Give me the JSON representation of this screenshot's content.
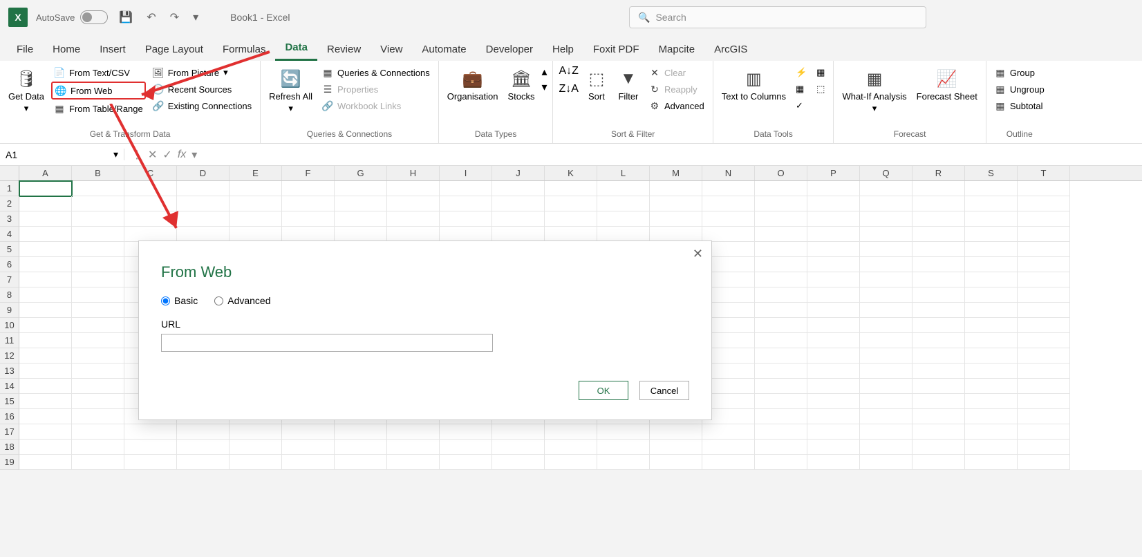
{
  "titlebar": {
    "autosave": "AutoSave",
    "doc_title": "Book1  - Excel",
    "search_placeholder": "Search"
  },
  "tabs": [
    "File",
    "Home",
    "Insert",
    "Page Layout",
    "Formulas",
    "Data",
    "Review",
    "View",
    "Automate",
    "Developer",
    "Help",
    "Foxit PDF",
    "Mapcite",
    "ArcGIS"
  ],
  "active_tab": "Data",
  "ribbon": {
    "get_transform": {
      "get_data": "Get Data",
      "from_text_csv": "From Text/CSV",
      "from_web": "From Web",
      "from_table_range": "From Table/Range",
      "from_picture": "From Picture",
      "recent_sources": "Recent Sources",
      "existing_connections": "Existing Connections",
      "label": "Get & Transform Data"
    },
    "queries": {
      "refresh_all": "Refresh All",
      "queries_connections": "Queries & Connections",
      "properties": "Properties",
      "workbook_links": "Workbook Links",
      "label": "Queries & Connections"
    },
    "data_types": {
      "organisation": "Organisation",
      "stocks": "Stocks",
      "label": "Data Types"
    },
    "sort_filter": {
      "sort": "Sort",
      "filter": "Filter",
      "clear": "Clear",
      "reapply": "Reapply",
      "advanced": "Advanced",
      "label": "Sort & Filter"
    },
    "data_tools": {
      "text_to_columns": "Text to Columns",
      "label": "Data Tools"
    },
    "forecast": {
      "what_if": "What-If Analysis",
      "forecast_sheet": "Forecast Sheet",
      "label": "Forecast"
    },
    "outline": {
      "group": "Group",
      "ungroup": "Ungroup",
      "subtotal": "Subtotal",
      "label": "Outline"
    }
  },
  "formula_bar": {
    "name_box": "A1",
    "fx": "fx"
  },
  "columns": [
    "A",
    "B",
    "C",
    "D",
    "E",
    "F",
    "G",
    "H",
    "I",
    "J",
    "K",
    "L",
    "M",
    "N",
    "O",
    "P",
    "Q",
    "R",
    "S",
    "T"
  ],
  "rows": [
    1,
    2,
    3,
    4,
    5,
    6,
    7,
    8,
    9,
    10,
    11,
    12,
    13,
    14,
    15,
    16,
    17,
    18,
    19
  ],
  "dialog": {
    "title": "From Web",
    "basic": "Basic",
    "advanced": "Advanced",
    "url_label": "URL",
    "url_value": "",
    "ok": "OK",
    "cancel": "Cancel"
  }
}
